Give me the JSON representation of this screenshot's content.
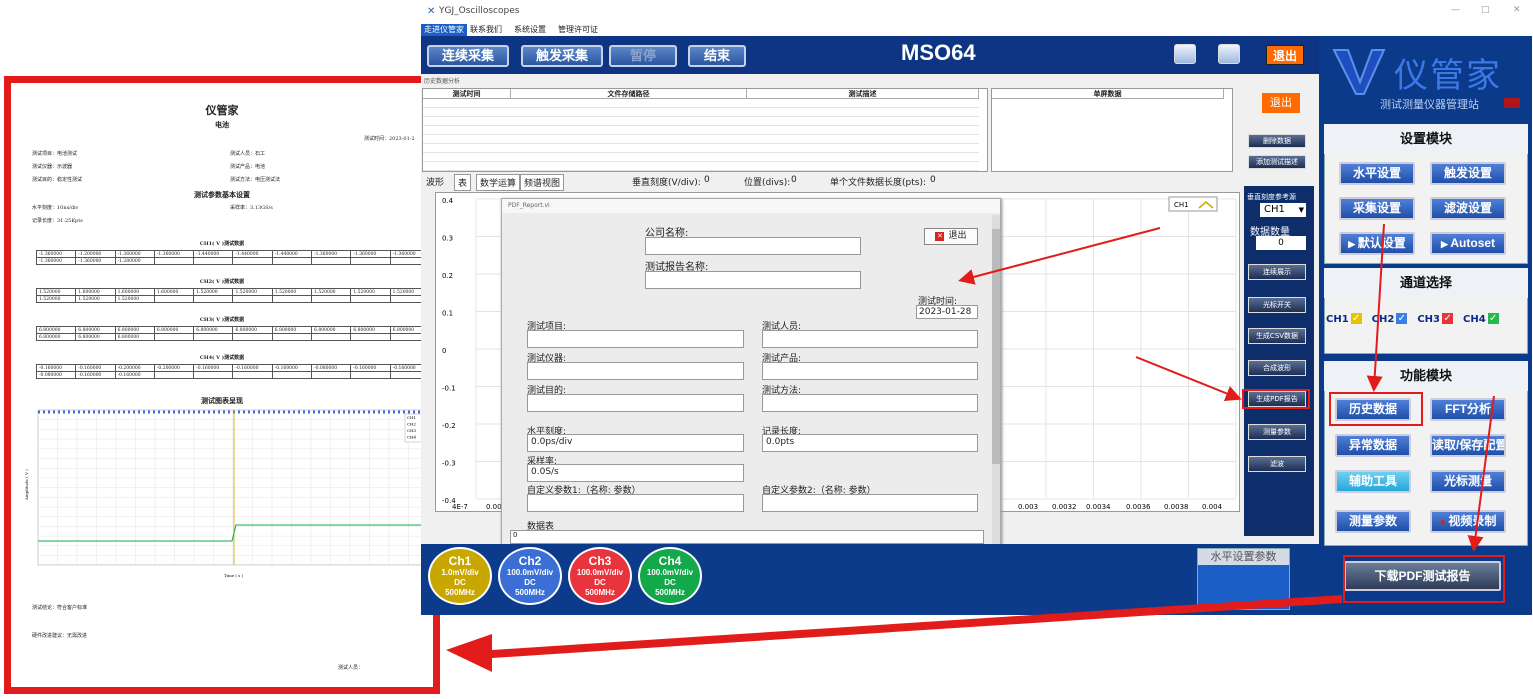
{
  "window": {
    "title": "YGJ_Oscilloscopes",
    "minimize": "—",
    "maximize": "□",
    "close": "✕"
  },
  "menu": [
    "走进仪管家",
    "联系我们",
    "系统设置",
    "管理许可证"
  ],
  "toolbar": {
    "continuous": "连续采集",
    "trigger": "触发采集",
    "pause": "暂停",
    "end": "结束",
    "model": "MSO64",
    "exit": "退出"
  },
  "history": {
    "tab_label": "历史数据分析",
    "columns": [
      "测试时间",
      "文件存储路径",
      "测试描述"
    ],
    "single_header": "单屏数据",
    "exit": "退出",
    "delete": "删除数据",
    "add_desc": "添加测试描述"
  },
  "viewtabs": {
    "tabs": [
      "波形",
      "表",
      "数学运算",
      "频谱视图"
    ],
    "vscale_label": "垂直刻度(V/div):",
    "vscale_value": "0",
    "pos_label": "位置(divs):",
    "pos_value": "0",
    "len_label": "单个文件数据长度(pts):",
    "len_value": "0"
  },
  "sidepanel": {
    "ref_label": "垂直刻度参考源",
    "ref_value": "CH1",
    "count_label": "数据数量",
    "count_value": "0",
    "buttons": [
      "连续展示",
      "光标开关",
      "生成CSV数据",
      "合成波形",
      "生成PDF报告",
      "测量参数",
      "滤波"
    ]
  },
  "plot": {
    "y_ticks": [
      "0.4",
      "0.3",
      "0.2",
      "0.1",
      "0",
      "-0.1",
      "-0.2",
      "-0.3",
      "-0.4"
    ],
    "x_ticks": [
      "4E-7",
      "0.00",
      "0.003",
      "0.0032",
      "0.0034",
      "0.0036",
      "0.0038",
      "0.004"
    ],
    "legend": "CH1"
  },
  "dialog": {
    "title": "PDF_Report.vi",
    "exit": "退出",
    "company_label": "公司名称:",
    "report_name_label": "测试报告名称:",
    "time_label": "测试时间:",
    "time_value": "2023-01-28",
    "project": "测试项目:",
    "person": "测试人员:",
    "instrument": "测试仪器:",
    "product": "测试产品:",
    "purpose": "测试目的:",
    "method": "测试方法:",
    "hscale_label": "水平刻度:",
    "hscale_value": "0.0ps/div",
    "reclen_label": "记录长度:",
    "reclen_value": "0.0pts",
    "rate_label": "采样率:",
    "rate_value": "0.0S/s",
    "custom1": "自定义参数1:（名称: 参数）",
    "custom2": "自定义参数2:（名称: 参数）",
    "table_label": "数据表",
    "table_value": "0"
  },
  "channels": [
    {
      "name": "Ch1",
      "scale": "1.0mV/div",
      "coupling": "DC",
      "bw": "500MHz",
      "color": "#c8a800"
    },
    {
      "name": "Ch2",
      "scale": "100.0mV/div",
      "coupling": "DC",
      "bw": "500MHz",
      "color": "#3b6fd6"
    },
    {
      "name": "Ch3",
      "scale": "100.0mV/div",
      "coupling": "DC",
      "bw": "500MHz",
      "color": "#e8343d"
    },
    {
      "name": "Ch4",
      "scale": "100.0mV/div",
      "coupling": "DC",
      "bw": "500MHz",
      "color": "#13a84a"
    }
  ],
  "hparams_title": "水平设置参数",
  "right": {
    "logo_text": "仪管家",
    "logo_sub": "测试测量仪器管理站",
    "settings_title": "设置模块",
    "settings": [
      "水平设置",
      "触发设置",
      "采集设置",
      "滤波设置",
      "默认设置",
      "Autoset"
    ],
    "channel_title": "通道选择",
    "ch_labels": [
      "CH1",
      "CH2",
      "CH3",
      "CH4"
    ],
    "func_title": "功能模块",
    "funcs": [
      "历史数据",
      "FFT分析",
      "异常数据",
      "读取/保存配置",
      "辅助工具",
      "光标测量",
      "测量参数",
      "视频录制"
    ],
    "download": "下载PDF测试报告"
  },
  "report": {
    "title": "仪管家",
    "subtitle": "电池",
    "test_time": "测试时间：2023-01-2",
    "info": [
      [
        "测试项目：电池测试",
        "测试人员：石工"
      ],
      [
        "测试仪器：示波器",
        "测试产品：电池"
      ],
      [
        "测试目的：稳定性测试",
        "测试方法：电压测试法"
      ]
    ],
    "params_title": "测试参数基本设置",
    "hscale": "水平刻度：10ns/div",
    "rate": "采样率：3.13GS/s",
    "reclen": "记录长度：31.25Kpts",
    "tables": [
      {
        "title": "CH1( V )测试数据",
        "row1": [
          "-1.360000",
          "-1.200000",
          "-1.360000",
          "-1.360000",
          "-1.440000",
          "-1.440000",
          "-1.440000",
          "-1.360000",
          "-1.360000",
          "-1.360000"
        ],
        "row2": [
          "-1.360000",
          "-1.360000",
          "-1.280000"
        ]
      },
      {
        "title": "CH2( V )测试数据",
        "row1": [
          "1.520000",
          "1.600000",
          "1.600000",
          "1.600000",
          "1.520000",
          "1.520000",
          "1.520000",
          "1.520000",
          "1.520000",
          "1.520000"
        ],
        "row2": [
          "1.520000",
          "1.520000",
          "1.520000"
        ]
      },
      {
        "title": "CH3( V )测试数据",
        "row1": [
          "6.800000",
          "6.800000",
          "6.800000",
          "6.800000",
          "6.800000",
          "6.800000",
          "6.800000",
          "6.800000",
          "6.800000",
          "6.800000"
        ],
        "row2": [
          "6.800000",
          "6.800000",
          "6.800000"
        ]
      },
      {
        "title": "CH4( V )测试数据",
        "row1": [
          "-0.160000",
          "-0.160000",
          "-0.200000",
          "-0.200000",
          "-0.160000",
          "-0.160000",
          "-0.160000",
          "-0.080000",
          "-0.160000",
          "-0.160000"
        ],
        "row2": [
          "-0.080000",
          "-0.160000",
          "-0.160000"
        ]
      }
    ],
    "chart_title": "测试图表呈现",
    "ylabel": "Amplitude ( V )",
    "xlabel": "Time ( s )",
    "legend": [
      "CH1",
      "CH2",
      "CH3",
      "CH4"
    ],
    "conclusion": "测试结论：符合客户标准",
    "suggest": "硬件改进建议：无需改进",
    "signer": "测试人员："
  }
}
